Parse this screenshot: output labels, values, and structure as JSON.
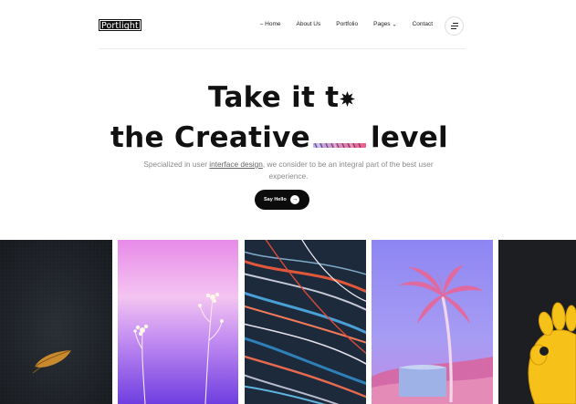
{
  "logo": {
    "text": "Portlight"
  },
  "nav": {
    "home": "Home",
    "about": "About Us",
    "portfolio": "Portfolio",
    "pages": "Pages",
    "contact": "Contact"
  },
  "hero": {
    "line1": "Take it t",
    "line2_start": "the Creative",
    "line2_end": "level",
    "subtitle_before": "Specialized in user ",
    "subtitle_link": "interface design",
    "subtitle_after": ", we consider to be an integral part of the best user experience.",
    "cta_label": "Say Hello"
  },
  "colors": {
    "accent": "#0c0c0c",
    "background": "#ffffff",
    "muted_text": "#8a8a8a"
  },
  "icons": {
    "nav_home": "dash-icon",
    "pages_dropdown": "chevron-down-icon",
    "menu": "hamburger-menu-icon",
    "cta": "arrow-right-icon",
    "hero_o": "starburst-icon"
  }
}
